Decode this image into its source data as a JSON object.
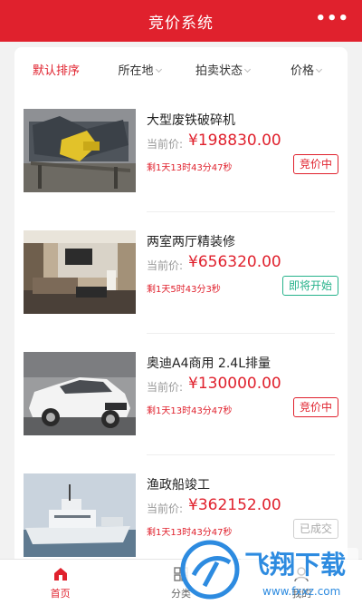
{
  "header": {
    "title": "竞价系统",
    "more_icon": "more-dots-icon"
  },
  "filters": [
    {
      "label": "默认排序",
      "active": true
    },
    {
      "label": "所在地",
      "active": false
    },
    {
      "label": "拍卖状态",
      "active": false
    },
    {
      "label": "价格",
      "active": false
    }
  ],
  "price_label": "当前价:",
  "items": [
    {
      "name": "大型废铁破碎机",
      "price": "¥198830.00",
      "countdown": "剩1天13时43分47秒",
      "status": "竞价中"
    },
    {
      "name": "两室两厅精装修",
      "price": "¥656320.00",
      "countdown": "剩1天5时43分3秒",
      "status": "即将开始"
    },
    {
      "name": "奥迪A4商用  2.4L排量",
      "price": "¥130000.00",
      "countdown": "剩1天13时43分47秒",
      "status": "竞价中"
    },
    {
      "name": "渔政船竣工",
      "price": "¥362152.00",
      "countdown": "剩1天13时43分47秒",
      "status": "已成交"
    }
  ],
  "tabbar": [
    {
      "label": "首页",
      "icon": "home-icon",
      "active": true
    },
    {
      "label": "分类",
      "icon": "category-icon",
      "active": false
    },
    {
      "label": "我的",
      "icon": "user-icon",
      "active": false
    }
  ],
  "watermark": {
    "line1": "飞翔下载",
    "line2": "www.fxxz.com"
  },
  "colors": {
    "brand": "#e0212d",
    "upcoming": "#26b28b",
    "done": "#aaaaaa"
  }
}
